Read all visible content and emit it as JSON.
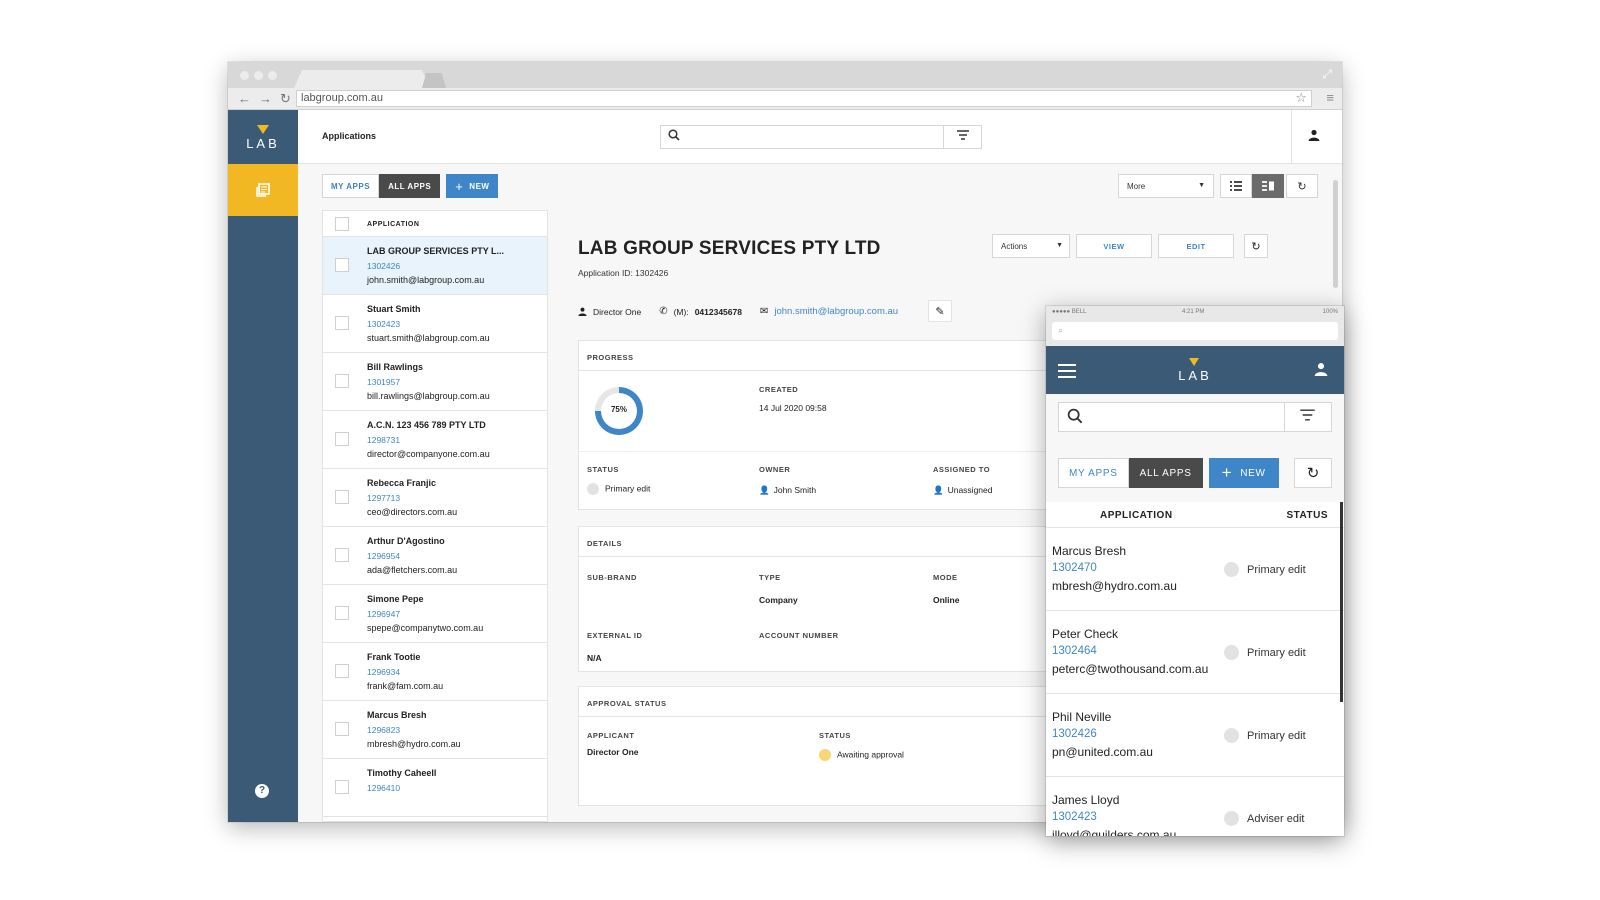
{
  "browser": {
    "url": "labgroup.com.au"
  },
  "app": {
    "logo": "LAB",
    "page_title": "Applications",
    "toolbar": {
      "my_apps": "MY APPS",
      "all_apps": "ALL APPS",
      "new": "NEW",
      "more": "More"
    },
    "list": {
      "header": "APPLICATION",
      "rows": [
        {
          "name": "LAB GROUP SERVICES PTY L...",
          "id": "1302426",
          "email": "john.smith@labgroup.com.au"
        },
        {
          "name": "Stuart Smith",
          "id": "1302423",
          "email": "stuart.smith@labgroup.com.au"
        },
        {
          "name": "Bill Rawlings",
          "id": "1301957",
          "email": "bill.rawlings@labgroup.com.au"
        },
        {
          "name": "A.C.N. 123 456 789 PTY LTD",
          "id": "1298731",
          "email": "director@companyone.com.au"
        },
        {
          "name": "Rebecca Franjic",
          "id": "1297713",
          "email": "ceo@directors.com.au"
        },
        {
          "name": "Arthur D'Agostino",
          "id": "1296954",
          "email": "ada@fletchers.com.au"
        },
        {
          "name": "Simone Pepe",
          "id": "1296947",
          "email": "spepe@companytwo.com.au"
        },
        {
          "name": "Frank Tootie",
          "id": "1296934",
          "email": "frank@fam.com.au"
        },
        {
          "name": "Marcus Bresh",
          "id": "1296823",
          "email": "mbresh@hydro.com.au"
        },
        {
          "name": "Timothy Caheell",
          "id": "1296410",
          "email": ""
        }
      ]
    },
    "detail": {
      "title": "LAB GROUP SERVICES PTY LTD",
      "app_id": "Application ID: 1302426",
      "actions": "Actions",
      "view": "VIEW",
      "edit": "EDIT",
      "contact_role": "Director One",
      "phone_label": "(M):",
      "phone": "0412345678",
      "email": "john.smith@labgroup.com.au",
      "progress": {
        "heading": "PROGRESS",
        "percent": 75,
        "percent_label": "75%",
        "created_label": "CREATED",
        "created": "14 Jul 2020 09:58",
        "status_label": "STATUS",
        "status": "Primary edit",
        "owner_label": "OWNER",
        "owner": "John Smith",
        "assigned_label": "ASSIGNED TO",
        "assigned": "Unassigned"
      },
      "details": {
        "heading": "DETAILS",
        "sub_brand_label": "SUB-BRAND",
        "type_label": "TYPE",
        "type": "Company",
        "mode_label": "MODE",
        "mode": "Online",
        "external_id_label": "EXTERNAL ID",
        "external_id": "N/A",
        "account_label": "ACCOUNT NUMBER"
      },
      "approval": {
        "heading": "APPROVAL STATUS",
        "applicant_label": "APPLICANT",
        "applicant": "Director One",
        "status_label": "STATUS",
        "status": "Awaiting approval",
        "status_color": "#f7d774"
      }
    }
  },
  "phone": {
    "status_left": "●●●●● BELL",
    "status_time": "4:21 PM",
    "status_right": "100%",
    "logo": "LAB",
    "my_apps": "MY APPS",
    "all_apps": "ALL APPS",
    "new": "NEW",
    "col_application": "APPLICATION",
    "col_status": "STATUS",
    "rows": [
      {
        "name": "Marcus Bresh",
        "id": "1302470",
        "email": "mbresh@hydro.com.au",
        "status": "Primary edit"
      },
      {
        "name": "Peter Check",
        "id": "1302464",
        "email": "peterc@twothousand.com.au",
        "status": "Primary edit"
      },
      {
        "name": "Phil Neville",
        "id": "1302426",
        "email": "pn@united.com.au",
        "status": "Primary edit"
      },
      {
        "name": "James Lloyd",
        "id": "1302423",
        "email": "jlloyd@guilders.com.au",
        "status": "Adviser edit"
      }
    ]
  },
  "colors": {
    "sidebar": "#3b5a76",
    "accent": "#f2b823",
    "link": "#3f86c8"
  }
}
